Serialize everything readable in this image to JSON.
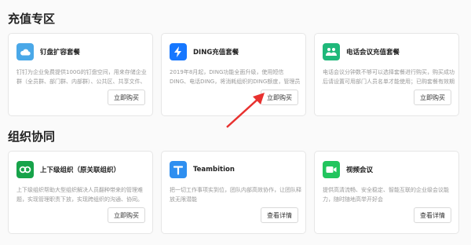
{
  "sections": [
    {
      "title": "充值专区",
      "cards": [
        {
          "title": "钉盘扩容套餐",
          "desc": "钉钉为企业免费提供100G的钉盘空间，用来存储企业群（全员群、部门群、内部群）、公共区、共享文件、微...",
          "button": "立即购买",
          "icon": "cloud-icon",
          "color": "#4aa8e8"
        },
        {
          "title": "DING充值套餐",
          "desc": "2019年8月起，DING功能全面升级，使用短信DING、电话DING，将消耗组织的DING额度，管理员可以为组织...",
          "button": "立即购买",
          "icon": "lightning-icon",
          "color": "#1677ff"
        },
        {
          "title": "电话会议充值套餐",
          "desc": "电话会议分钟数不够可以选择套餐进行购买，购买成功后请设置可用部门人员名单才能使用；已购套餐有效期为...",
          "button": "立即购买",
          "icon": "conference-icon",
          "color": "#1fb87a"
        }
      ]
    },
    {
      "title": "组织协同",
      "cards": [
        {
          "title": "上下级组织（原关联组织）",
          "desc": "上下级组织帮助大型组织解决人员翻种带来的管理难题，实现管理职责下放，实现跨组织的沟通、协同。",
          "button": "立即购买",
          "icon": "link-icon",
          "color": "#17a34a"
        },
        {
          "title": "Teambition",
          "desc": "把一切工作事项实到位，团队内部高效协作，让团队释放无限潜能",
          "button": "查看详情",
          "icon": "teambition-icon",
          "color": "#2f8ff0"
        },
        {
          "title": "视频会议",
          "desc": "提供高清流畅、安全稳定、智能互联的企业级会议能力，随时随地高举开好会",
          "button": "查看详情",
          "icon": "video-icon",
          "color": "#22c55e"
        }
      ]
    }
  ]
}
